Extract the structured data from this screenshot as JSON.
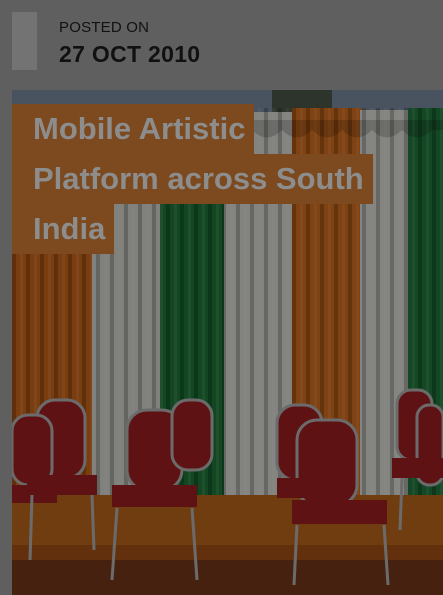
{
  "post": {
    "posted_label": "POSTED ON",
    "date": "27 OCT 2010",
    "title_lines": [
      "Mobile Artistic",
      "Platform across South",
      "India"
    ]
  },
  "colors": {
    "page_background": "#5f5f5f",
    "title_background": "#7c4a1e",
    "title_text": "#8d8d8d",
    "date_accent_bar": "#737373"
  },
  "image": {
    "subject": "stage with orange, white and green draped curtains and red cushioned chairs"
  }
}
